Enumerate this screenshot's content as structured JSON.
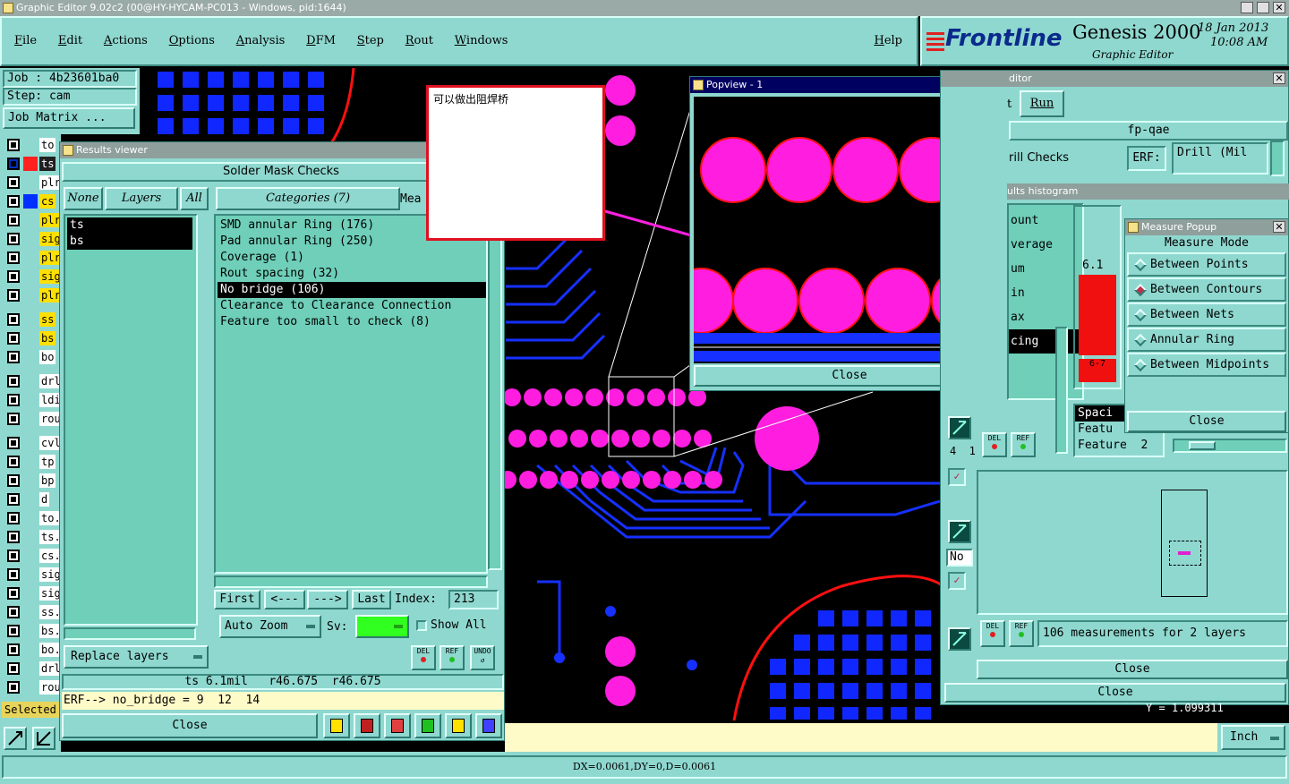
{
  "window_title": "Graphic Editor 9.02c2 (00@HY-HYCAM-PC013 - Windows, pid:1644)",
  "menu": [
    "File",
    "Edit",
    "Actions",
    "Options",
    "Analysis",
    "DFM",
    "Step",
    "Rout",
    "Windows"
  ],
  "help": "Help",
  "brand": {
    "logo": "Frontline",
    "product": "Genesis 2000",
    "subtitle": "Graphic Editor",
    "date": "18 Jan 2013",
    "time": "10:08 AM"
  },
  "job": {
    "job_label": "Job : 4b23601ba0",
    "step_label": "Step: cam",
    "matrix_btn": "Job Matrix ..."
  },
  "layers": [
    {
      "name": "to",
      "color": "#ffffff"
    },
    {
      "name": "ts",
      "color": "#ff2020",
      "selected": true
    },
    {
      "name": "plr",
      "color": "#ffffff"
    },
    {
      "name": "cs",
      "color": "#ffe000",
      "swatch": "#0030ff"
    },
    {
      "name": "plr",
      "color": "#ffe000"
    },
    {
      "name": "sig",
      "color": "#ffe000"
    },
    {
      "name": "plr",
      "color": "#ffe000"
    },
    {
      "name": "sig",
      "color": "#ffe000"
    },
    {
      "name": "plr",
      "color": "#ffe000"
    },
    {
      "name": "ss",
      "color": "#ffe000"
    },
    {
      "name": "bs",
      "color": "#ffe000"
    },
    {
      "name": "bo",
      "color": "#ffffff"
    },
    {
      "name": "drl",
      "color": "#ffffff"
    },
    {
      "name": "ldi",
      "color": "#ffffff"
    },
    {
      "name": "rou",
      "color": "#ffffff"
    },
    {
      "name": "cvl",
      "color": "#ffffff"
    },
    {
      "name": "tp",
      "color": "#ffffff"
    },
    {
      "name": "bp",
      "color": "#ffffff"
    },
    {
      "name": "d",
      "color": "#ffffff"
    },
    {
      "name": "to.",
      "color": "#ffffff"
    },
    {
      "name": "ts.",
      "color": "#ffffff"
    },
    {
      "name": "cs.",
      "color": "#ffffff"
    },
    {
      "name": "sig",
      "color": "#ffffff"
    },
    {
      "name": "sig",
      "color": "#ffffff"
    },
    {
      "name": "ss.",
      "color": "#ffffff"
    },
    {
      "name": "bs.",
      "color": "#ffffff"
    },
    {
      "name": "bo.",
      "color": "#ffffff"
    },
    {
      "name": "drl",
      "color": "#ffffff"
    },
    {
      "name": "rou",
      "color": "#ffffff"
    }
  ],
  "selected_label": "Selected",
  "results_viewer": {
    "title": "Results viewer",
    "header": "Solder Mask Checks",
    "none_btn": "None",
    "layers_btn": "Layers",
    "all_btn": "All",
    "categories_btn": "Categories (7)",
    "meas_label": "Mea",
    "layer_list": [
      "ts",
      "bs"
    ],
    "categories": [
      "SMD annular Ring (176)",
      "Pad annular Ring (250)",
      "Coverage (1)",
      "Rout spacing (32)",
      "No bridge (106)",
      "Clearance to Clearance Connection",
      "Feature too small to check (8)"
    ],
    "selected_category": 4,
    "first_btn": "First",
    "prev_btn": "<---",
    "next_btn": "--->",
    "last_btn": "Last",
    "index_label": "Index:",
    "index_value": "213",
    "auto_zoom": "Auto Zoom",
    "sv_label": "Sv:",
    "show_all": "Show All",
    "replace_layers": "Replace layers",
    "del": "DEL",
    "ref": "REF",
    "undo": "UNDO",
    "measure_line": "ts 6.1mil   r46.675  r46.675",
    "erf_line": "ERF--> no_bridge = 9  12  14",
    "close": "Close"
  },
  "note_text": "可以做出阻焊桥",
  "popview": {
    "title": "Popview - 1",
    "close": "Close"
  },
  "editor": {
    "title_frag": "ditor",
    "t_label": "t",
    "run_btn": "Run",
    "program": "fp-qae",
    "check_label": "rill Checks",
    "erf_label": "ERF:",
    "erf_value": "Drill (Mil",
    "histogram_title": "ults histogram",
    "hist_items": [
      "ount",
      "verage",
      "um",
      "in",
      "ax",
      "cing"
    ],
    "hist_value": "6.1",
    "hist_bar2": "6-7",
    "feature_rows": [
      "Spaci",
      "Featu",
      "Feature  2"
    ],
    "no_label": "No",
    "four_label": "4  1",
    "measurements": "106 measurements for 2 layers",
    "close1": "Close",
    "close2": "Close"
  },
  "measure_popup": {
    "title": "Measure Popup",
    "mode_label": "Measure Mode",
    "options": [
      "Between Points",
      "Between Contours",
      "Between Nets",
      "Annular Ring",
      "Between Midpoints"
    ],
    "selected": 1,
    "close": "Close"
  },
  "y_readout": "Y = 1.099311",
  "units_btn": "Inch",
  "status": "DX=0.0061,DY=0,D=0.0061"
}
